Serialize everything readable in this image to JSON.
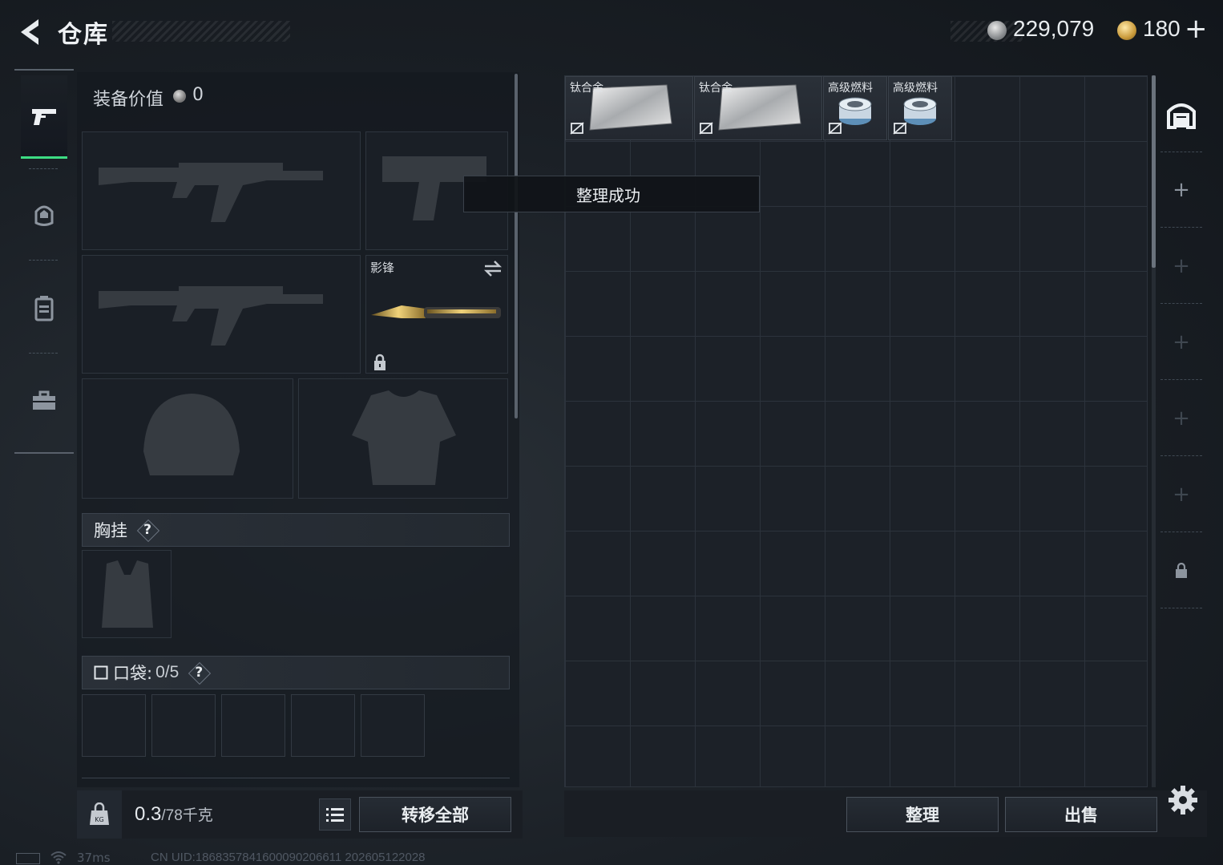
{
  "header": {
    "title": "仓库",
    "silver_currency": "229,079",
    "gold_currency": "180",
    "add_label": "+"
  },
  "categories": [
    "weapon-icon",
    "helmet-icon",
    "backpack-icon",
    "toolbox-icon"
  ],
  "equipment": {
    "value_label": "装备价值",
    "value": "0",
    "melee_name": "影锋",
    "chest_rig_label": "胸挂",
    "pockets_label": "口袋:",
    "pockets_count": "0/5",
    "help": "?"
  },
  "footer_left": {
    "weight_current": "0.3",
    "weight_total": "/78千克",
    "transfer_all": "转移全部"
  },
  "storage": {
    "items": [
      {
        "name": "钛合金",
        "kind": "plate"
      },
      {
        "name": "钛合金",
        "kind": "plate"
      },
      {
        "name": "高级燃料",
        "kind": "can"
      },
      {
        "name": "高级燃料",
        "kind": "can"
      }
    ],
    "toast": "整理成功",
    "sort": "整理",
    "sell": "出售"
  },
  "status_bar": {
    "ping": "37ms",
    "uid": "CN UID:1868357841600090206611 202605122028"
  },
  "colors": {
    "accent": "#3ddc84",
    "gold": "#c99a3b",
    "silver": "#8a8d90"
  }
}
